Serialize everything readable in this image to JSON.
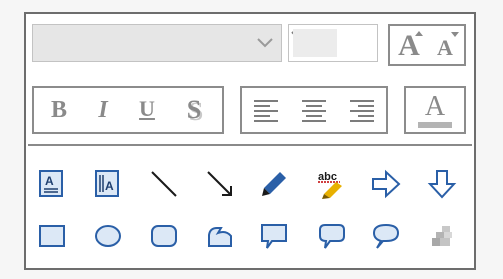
{
  "toolbar": {
    "font_name": {
      "value": "",
      "icon": "chevron-down-icon"
    },
    "font_size": {
      "value": "",
      "icon": "chevron-down-icon"
    },
    "grow_font": {
      "label": "A",
      "icon": "grow-font-icon"
    },
    "shrink_font": {
      "label": "A",
      "icon": "shrink-font-icon"
    },
    "bold": {
      "label": "B"
    },
    "italic": {
      "label": "I"
    },
    "underline": {
      "label": "U"
    },
    "shadow": {
      "label": "S"
    },
    "font_color": {
      "label": "A",
      "underline_color": "#b4b4b4"
    },
    "align": [
      "align-left-icon",
      "align-center-icon",
      "align-right-icon"
    ]
  },
  "shapes": {
    "row1": [
      "text-box-icon",
      "vertical-text-box-icon",
      "line-icon",
      "arrow-line-icon",
      "pencil-icon",
      "spell-check-icon",
      "right-arrow-icon",
      "down-arrow-icon"
    ],
    "row2": [
      "rectangle-icon",
      "oval-icon",
      "rounded-rectangle-icon",
      "freeform-shape-icon",
      "rectangular-callout-icon",
      "rounded-callout-icon",
      "oval-callout-icon",
      "more-shapes-icon"
    ]
  },
  "colors": {
    "disabled_text": "#8a8a8a",
    "icon_blue": "#2a5fa7",
    "icon_fill": "#dce8f6",
    "pencil_yellow": "#e8b000"
  }
}
